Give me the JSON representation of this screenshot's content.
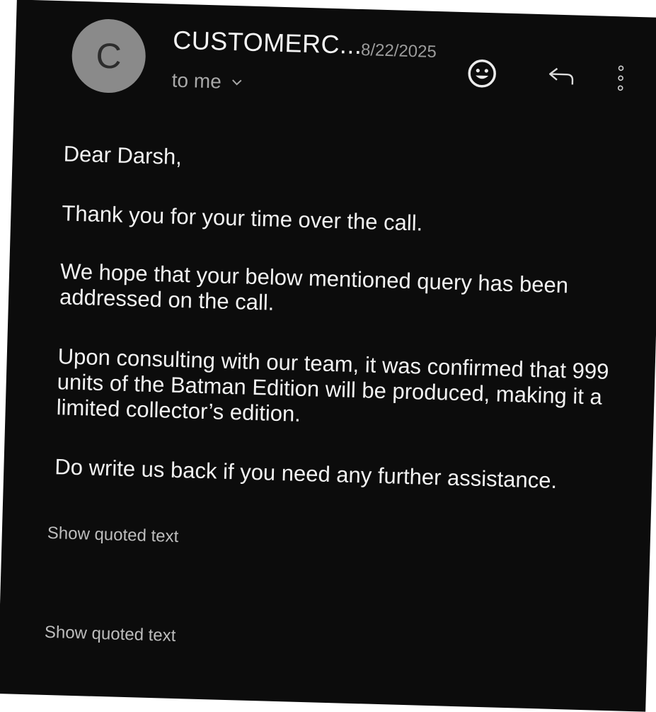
{
  "email": {
    "avatar_letter": "C",
    "sender": "CUSTOMERC...",
    "date": "8/22/2025",
    "recipient": "to me",
    "icons": {
      "emoji": "smiley-face-icon",
      "reply": "reply-arrow-icon",
      "more": "vertical-dots-icon",
      "expand": "chevron-down-icon"
    },
    "body": {
      "greeting": "Dear Darsh,",
      "paragraph_1": "Thank you for your time over the call.",
      "paragraph_2": "We hope that your below mentioned query has been addressed on the call.",
      "paragraph_3": "Upon consulting with our team, it was confirmed that 999 units of the Batman Edition will be produced, making it a limited collector’s edition.",
      "paragraph_4": "Do write us back if you need any further assistance."
    },
    "quoted_links": [
      "Show quoted text",
      "Show quoted text"
    ]
  },
  "colors": {
    "background": "#0c0c0c",
    "avatar": "#8a8a8a",
    "text": "#f2f2f2",
    "muted": "#9c9c9c"
  }
}
